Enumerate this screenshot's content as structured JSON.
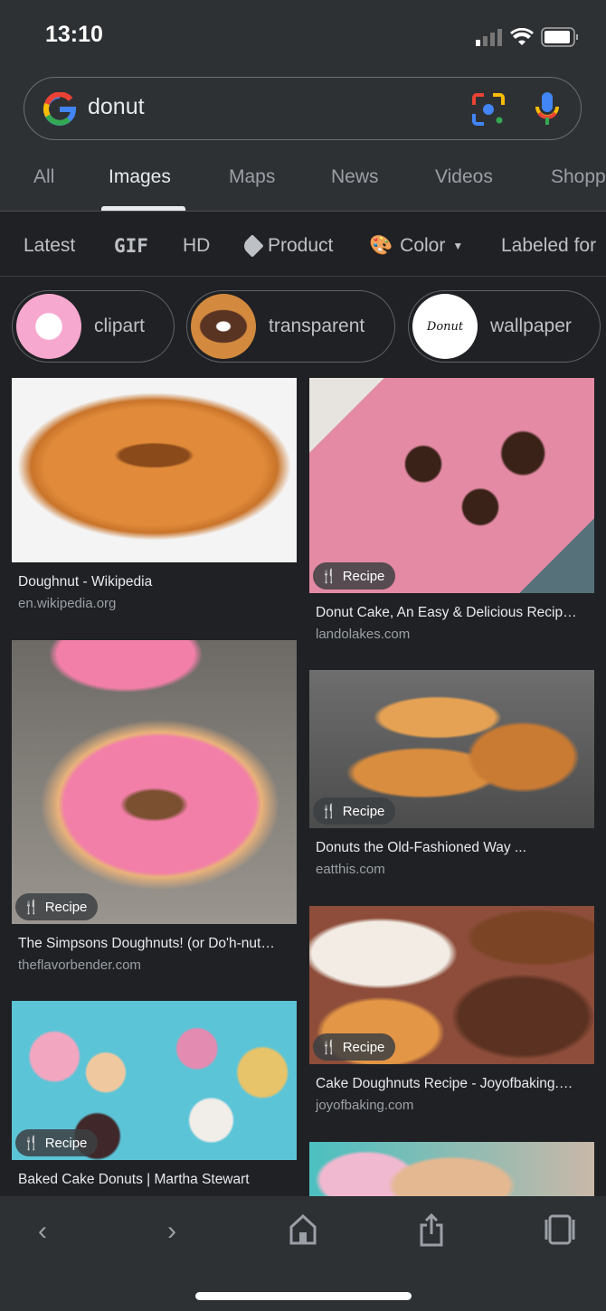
{
  "status": {
    "time": "13:10"
  },
  "search": {
    "query": "donut"
  },
  "tabs": [
    "All",
    "Images",
    "Maps",
    "News",
    "Videos",
    "Shopp"
  ],
  "active_tab": "Images",
  "filters": {
    "latest": "Latest",
    "gif": "GIF",
    "hd": "HD",
    "product": "Product",
    "color": "Color",
    "labeled": "Labeled for"
  },
  "chips": [
    {
      "label": "clipart"
    },
    {
      "label": "transparent"
    },
    {
      "label": "wallpaper"
    }
  ],
  "results": [
    {
      "title": "Doughnut - Wikipedia",
      "source": "en.wikipedia.org"
    },
    {
      "title": "Donut Cake, An Easy & Delicious Recip…",
      "source": "landolakes.com",
      "badge": "Recipe"
    },
    {
      "title": "The Simpsons Doughnuts! (or Do'h-nut…",
      "source": "theflavorbender.com",
      "badge": "Recipe"
    },
    {
      "title": "Donuts the Old-Fashioned Way ...",
      "source": "eatthis.com",
      "badge": "Recipe"
    },
    {
      "title": "Baked Cake Donuts | Martha Stewart",
      "source": "",
      "badge": "Recipe"
    },
    {
      "title": "Cake Doughnuts Recipe - Joyofbaking.…",
      "source": "joyofbaking.com",
      "badge": "Recipe"
    }
  ],
  "colors": {
    "background": "#202124",
    "header": "#2e3134"
  }
}
